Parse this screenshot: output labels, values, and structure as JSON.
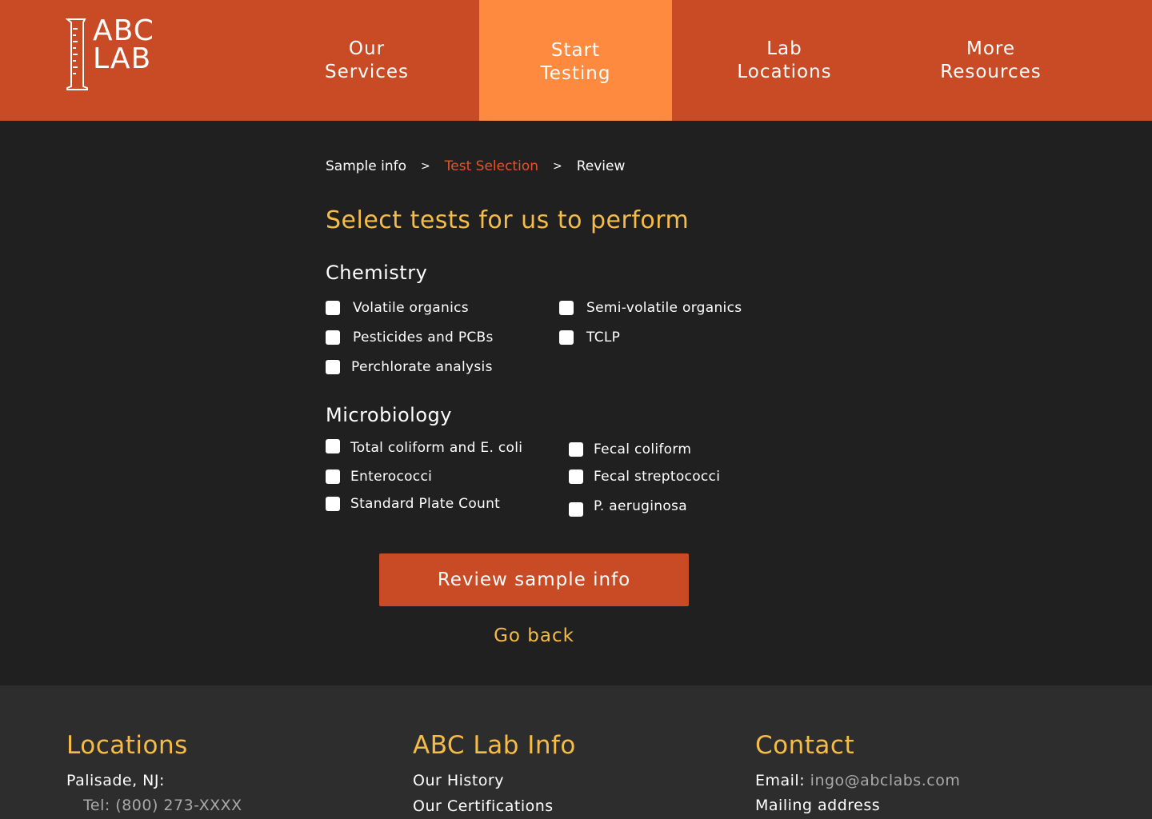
{
  "brand": {
    "line1": "ABC",
    "line2": "LAB"
  },
  "nav": {
    "services": "Our\nServices",
    "start": "Start\nTesting",
    "locations": "Lab\nLocations",
    "resources": "More\nResources"
  },
  "breadcrumb": {
    "step1": "Sample info",
    "sep1": ">",
    "step2": "Test Selection",
    "sep2": ">",
    "step3": "Review"
  },
  "page_title": "Select tests for us to perform",
  "chemistry": {
    "title": "Chemistry",
    "tests": [
      "Volatile organics",
      "Semi-volatile organics",
      "Pesticides and PCBs",
      "TCLP",
      "Perchlorate analysis"
    ]
  },
  "microbiology": {
    "title": "Microbiology",
    "tests": [
      "Total coliform and E. coli",
      "Fecal coliform",
      "Enterococci",
      "Fecal streptococci",
      "Standard Plate Count",
      "P. aeruginosa"
    ]
  },
  "actions": {
    "primary": "Review sample info",
    "back": "Go back"
  },
  "footer": {
    "locations": {
      "title": "Locations",
      "line1": "Palisade, NJ:",
      "line2": "Tel: (800) 273-XXXX"
    },
    "info": {
      "title": "ABC Lab Info",
      "line1": "Our History",
      "line2": "Our Certifications"
    },
    "contact": {
      "title": "Contact",
      "email_label": "Email:",
      "email": "ingo@abclabs.com",
      "line2": "Mailing address"
    }
  },
  "colors": {
    "header": "#c94b25",
    "nav_active": "#fe8a3f",
    "accent_yellow": "#f5bd47",
    "breadcrumb_active": "#e0552a",
    "background": "#202020",
    "footer": "#2d2d2d"
  }
}
